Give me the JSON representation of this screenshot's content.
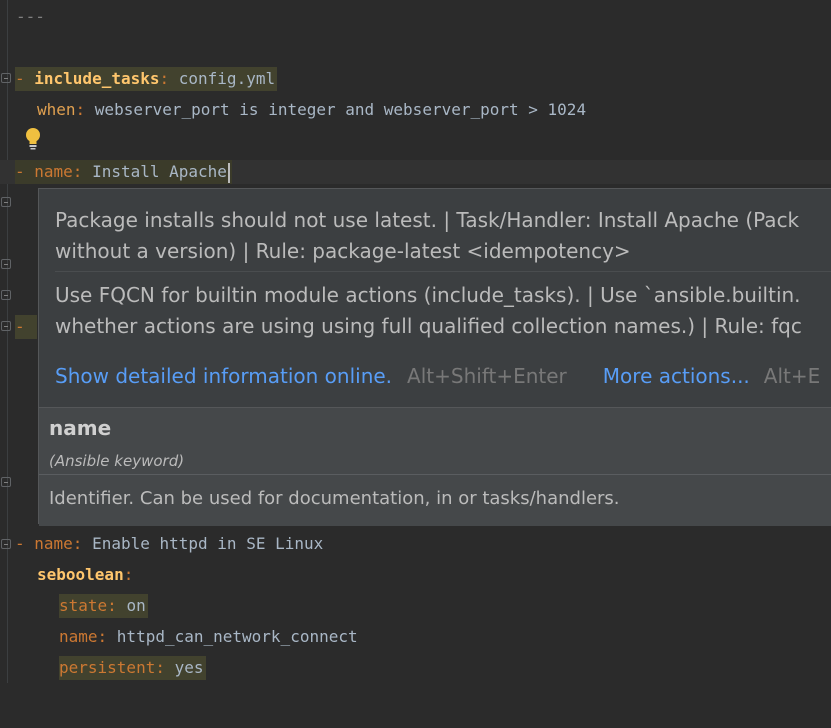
{
  "editor": {
    "line1": "---",
    "task1": {
      "dash": "- ",
      "key": "include_tasks",
      "sep": ": ",
      "value": "config.yml"
    },
    "task1_when": {
      "key": "when",
      "sep": ": ",
      "value": "webserver_port is integer and webserver_port > 1024"
    },
    "task2": {
      "dash": "- ",
      "key": "name",
      "sep": ": ",
      "value": "Install Apache"
    },
    "task3": {
      "dash": "- ",
      "key": "name",
      "sep": ": ",
      "value": "Enable httpd in SE Linux"
    },
    "task3_module": {
      "key": "seboolean",
      "sep": ":"
    },
    "task3_state": {
      "key": "state",
      "sep": ": ",
      "value": "on"
    },
    "task3_name": {
      "key": "name",
      "sep": ": ",
      "value": "httpd_can_network_connect"
    },
    "task3_persistent": {
      "key": "persistent",
      "sep": ": ",
      "value": "yes"
    },
    "partial_dash": "-"
  },
  "popup": {
    "msg1_line1": "Package installs should not use latest. | Task/Handler: Install Apache (Pack",
    "msg1_line2": "without a version) | Rule: package-latest <idempotency>",
    "msg2_line1": "Use FQCN for builtin module actions (include_tasks). | Use `ansible.builtin.",
    "msg2_line2": "whether actions are using using full qualified collection names.) | Rule: fqc",
    "action1_label": "Show detailed information online.",
    "action1_shortcut": "Alt+Shift+Enter",
    "action2_label": "More actions...",
    "action2_shortcut": "Alt+E",
    "doc_title": "name",
    "doc_subtitle": "(Ansible keyword)",
    "doc_body": "Identifier. Can be used for documentation, in or tasks/handlers."
  },
  "colors": {
    "accent_link": "#589df6",
    "key": "#cc7832",
    "key_highlight": "#ffc66d"
  },
  "icons": {
    "intention": "lightbulb-icon",
    "fold": "fold-marker-icon"
  }
}
